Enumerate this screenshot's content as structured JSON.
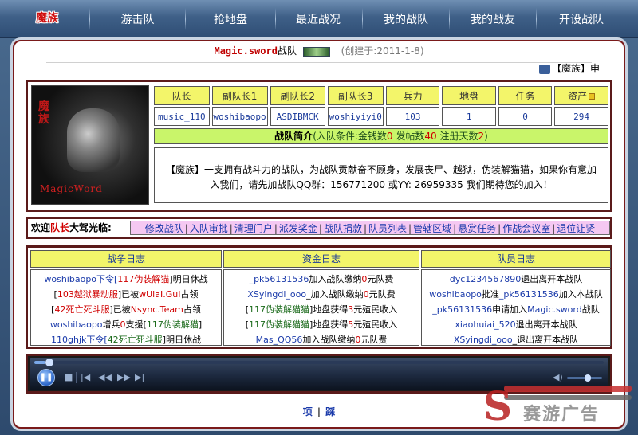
{
  "nav": {
    "logo": "魔族",
    "items": [
      "游击队",
      "抢地盘",
      "最近战况",
      "我的战队",
      "我的战友",
      "开设战队"
    ]
  },
  "header": {
    "clan_name": "Magic.sword",
    "suffix": "战队",
    "created": "(创建于:2011-1-8)",
    "marquee": "【魔族】申"
  },
  "avatar": {
    "vertical_text": "魔族",
    "bottom_text": "MagicWord"
  },
  "stats": {
    "headers": [
      "队长",
      "副队长1",
      "副队长2",
      "副队长3",
      "兵力",
      "地盘",
      "任务",
      "资产"
    ],
    "values": [
      "music_110",
      "woshibaopo",
      "ASDIBMCK",
      "woshiyiyi0",
      "103",
      "1",
      "0",
      "294"
    ]
  },
  "intro": {
    "title": "战队简介",
    "cond_prefix": "(入队条件:金钱数",
    "money": "0",
    "posts_label": " 发帖数",
    "posts": "40",
    "days_label": " 注册天数",
    "days": "2",
    "cond_suffix": ")",
    "body": "【魔族】一支拥有战斗力的战队，为战队贡献奋不顾身，发展丧尸、越狱，伪装解猫猫，如果你有意加入我们，请先加战队QQ群：156771200 或YY: 26959335 我们期待您的加入！"
  },
  "welcome": {
    "prefix": "欢迎",
    "rank": "队长",
    "suffix": "大驾光临:"
  },
  "actions": [
    "修改战队",
    "入队审批",
    "清理门户",
    "派发奖金",
    "战队捐款",
    "队员列表",
    "管辖区域",
    "悬赏任务",
    "作战会议室",
    "退位让贤"
  ],
  "logs": {
    "war": {
      "title": "战争日志",
      "lines": [
        [
          [
            "woshibaopo",
            "blue"
          ],
          [
            "下令[",
            "blue"
          ],
          [
            "117伪装解猫",
            "red"
          ],
          [
            "]明日休战",
            ""
          ]
        ],
        [
          [
            "[",
            ""
          ],
          [
            "103越狱暴动服",
            "red"
          ],
          [
            "]已被",
            ""
          ],
          [
            "wUlaI.GuI",
            "red"
          ],
          [
            "占领",
            ""
          ]
        ],
        [
          [
            "[",
            ""
          ],
          [
            "42死亡死斗服",
            "red"
          ],
          [
            "]已被",
            ""
          ],
          [
            "Nsync.Team",
            "red"
          ],
          [
            "占领",
            ""
          ]
        ],
        [
          [
            "woshibaopo",
            "blue"
          ],
          [
            "增兵",
            ""
          ],
          [
            "0",
            "red"
          ],
          [
            "支援[",
            ""
          ],
          [
            "117伪装解猫",
            "grn"
          ],
          [
            "]",
            ""
          ]
        ],
        [
          [
            "110ghjk",
            "blue"
          ],
          [
            "下令[",
            "blue"
          ],
          [
            "42死亡死斗服",
            "grn"
          ],
          [
            "]明日休战",
            ""
          ]
        ]
      ]
    },
    "money": {
      "title": "资金日志",
      "lines": [
        [
          [
            "_pk56131536",
            "blue"
          ],
          [
            "加入战队缴纳",
            ""
          ],
          [
            "0",
            "red"
          ],
          [
            "元队费",
            ""
          ]
        ],
        [
          [
            "XSyingdi_ooo",
            "blue"
          ],
          [
            "_加入战队缴纳",
            ""
          ],
          [
            "0",
            "red"
          ],
          [
            "元队费",
            ""
          ]
        ],
        [
          [
            "[",
            ""
          ],
          [
            "117伪装解猫猫",
            "grn"
          ],
          [
            "]地盘获得",
            ""
          ],
          [
            "3",
            "red"
          ],
          [
            "元殖民收入",
            ""
          ]
        ],
        [
          [
            "[",
            ""
          ],
          [
            "117伪装解猫猫",
            "grn"
          ],
          [
            "]地盘获得",
            ""
          ],
          [
            "5",
            "red"
          ],
          [
            "元殖民收入",
            ""
          ]
        ],
        [
          [
            "Mas_QQ56",
            "blue"
          ],
          [
            "加入战队缴纳",
            ""
          ],
          [
            "0",
            "red"
          ],
          [
            "元队费",
            ""
          ]
        ]
      ]
    },
    "members": {
      "title": "队员日志",
      "lines": [
        [
          [
            "dyc1234567890",
            "blue"
          ],
          [
            "退出离开本战队",
            ""
          ]
        ],
        [
          [
            "woshibaopo",
            "blue"
          ],
          [
            "批准",
            ""
          ],
          [
            "_pk56131536",
            "blue"
          ],
          [
            "加入本战队",
            ""
          ]
        ],
        [
          [
            "_pk56131536",
            "blue"
          ],
          [
            "申请加入",
            ""
          ],
          [
            "Magic.sword",
            "blue"
          ],
          [
            "战队",
            ""
          ]
        ],
        [
          [
            "xiaohuiai_520",
            "blue"
          ],
          [
            "退出离开本战队",
            ""
          ]
        ],
        [
          [
            "XSyingdi_ooo",
            "blue"
          ],
          [
            "_退出离开本战队",
            ""
          ]
        ]
      ]
    }
  },
  "player": {
    "progress": 0.02,
    "volume": 0.6
  },
  "pager": {
    "prev": "项",
    "sep": "|",
    "next": "踩"
  },
  "watermark": {
    "letter": "S",
    "word": "赛游广告"
  }
}
